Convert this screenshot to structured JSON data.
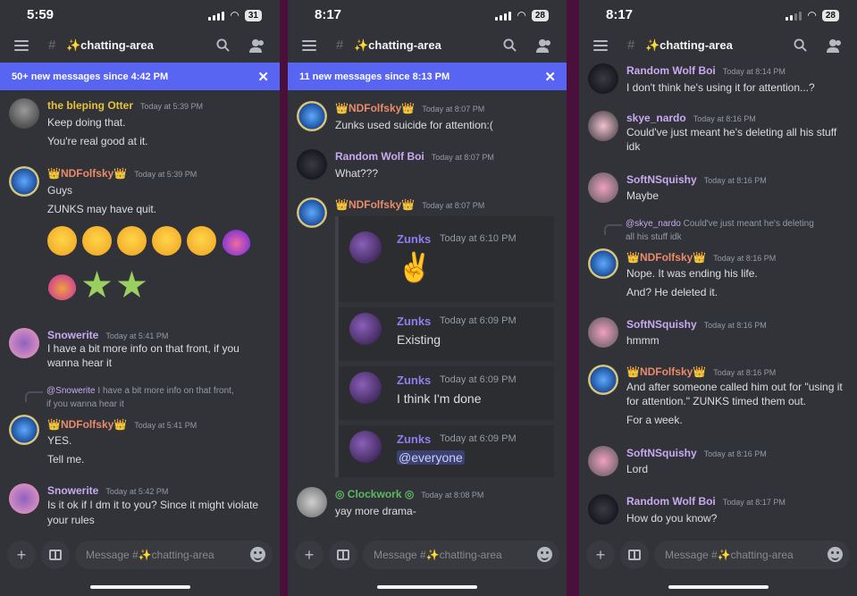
{
  "channel": "✨chatting-area",
  "composer_placeholder": "Message #✨chatting-area",
  "colors": {
    "otter": "#e7c23a",
    "ndf": "#ec8a6a",
    "snowerite": "#c9a9f0",
    "random": "#c9a9f0",
    "skye": "#c9a9f0",
    "softn": "#c9a9f0",
    "clockwork": "#5fb85f",
    "zunks": "#8e7ff0",
    "banner": "#5865f2"
  },
  "panel1": {
    "time": "5:59",
    "battery": "31",
    "banner": "50+ new messages since 4:42 PM",
    "messages": [
      {
        "user": "the bleping Otter",
        "time": "Today at 5:39 PM",
        "lines": [
          "Keep doing that.",
          "You're real good at it."
        ]
      },
      {
        "user": "👑NDFolfsky👑",
        "time": "Today at 5:39 PM",
        "lines": [
          "Guys",
          "ZUNKS may have quit."
        ]
      },
      {
        "user": "Snowerite",
        "time": "Today at 5:41 PM",
        "lines": [
          "I have a bit more info on that front, if you",
          "wanna hear it"
        ]
      },
      {
        "reply_user": "@Snowerite",
        "reply_text": "I have a bit more info on that front,",
        "reply_text2": "if you wanna hear it",
        "user": "👑NDFolfsky👑",
        "time": "Today at 5:41 PM",
        "lines": [
          "YES.",
          "Tell me."
        ]
      },
      {
        "user": "Snowerite",
        "time": "Today at 5:42 PM",
        "lines": [
          "Is it ok if I dm it to you? Since it might violate",
          "your rules"
        ]
      }
    ]
  },
  "panel2": {
    "time": "8:17",
    "battery": "28",
    "banner": "11 new messages since 8:13 PM",
    "messages": [
      {
        "user": "👑NDFolfsky👑",
        "time": "Today at 8:07 PM",
        "lines": [
          "Zunks used suicide for attention:("
        ]
      },
      {
        "user": "Random Wolf Boi",
        "time": "Today at 8:07 PM",
        "lines": [
          "What???"
        ]
      },
      {
        "user": "👑NDFolfsky👑",
        "time": "Today at 8:07 PM",
        "lines": []
      },
      {
        "user": "◎ Clockwork ◎",
        "time": "Today at 8:08 PM",
        "lines": [
          "yay more drama-"
        ]
      }
    ],
    "forwarded": [
      {
        "user": "Zunks",
        "time": "Today at 6:10 PM",
        "text": "✌️"
      },
      {
        "user": "Zunks",
        "time": "Today at 6:09 PM",
        "text": "Existing"
      },
      {
        "user": "Zunks",
        "time": "Today at 6:09 PM",
        "text": "I think I'm done"
      },
      {
        "user": "Zunks",
        "time": "Today at 6:09 PM",
        "text": "@everyone"
      }
    ]
  },
  "panel3": {
    "time": "8:17",
    "battery": "28",
    "messages": [
      {
        "user": "Random Wolf Boi",
        "time": "Today at 8:14 PM",
        "lines": [
          "I don't think he's using it for attention...?"
        ]
      },
      {
        "user": "skye_nardo",
        "time": "Today at 8:16 PM",
        "lines": [
          "Could've just meant he's deleting all his stuff",
          "idk"
        ]
      },
      {
        "user": "SoftNSquishy",
        "time": "Today at 8:16 PM",
        "lines": [
          "Maybe"
        ]
      },
      {
        "reply_user": "@skye_nardo",
        "reply_text": "Could've just meant he's deleting",
        "reply_text2": "all his stuff idk",
        "user": "👑NDFolfsky👑",
        "time": "Today at 8:16 PM",
        "lines": [
          "Nope. It was ending his life.",
          "And? He deleted it."
        ]
      },
      {
        "user": "SoftNSquishy",
        "time": "Today at 8:16 PM",
        "lines": [
          "hmmm"
        ]
      },
      {
        "user": "👑NDFolfsky👑",
        "time": "Today at 8:16 PM",
        "lines": [
          "And after someone called him out for \"using it",
          "for attention.\" ZUNKS timed them out.",
          "For a week."
        ]
      },
      {
        "user": "SoftNSquishy",
        "time": "Today at 8:16 PM",
        "lines": [
          "Lord"
        ]
      },
      {
        "user": "Random Wolf Boi",
        "time": "Today at 8:17 PM",
        "lines": [
          "How do you know?"
        ]
      }
    ]
  }
}
